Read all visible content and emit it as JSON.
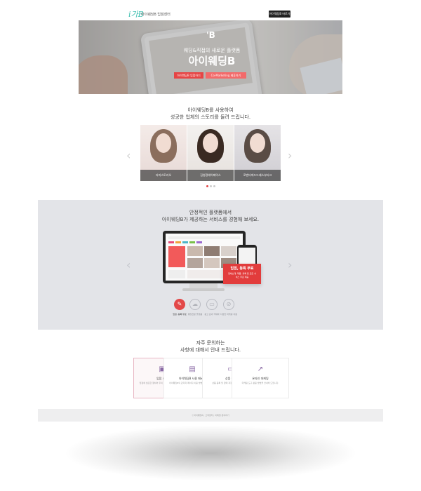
{
  "header": {
    "logo_mark": "i가B",
    "logo_text": "아이웨딩B 입점센터",
    "top_button": "아이웨딩B 바로가기"
  },
  "hero": {
    "badge": "'B",
    "subtitle": "웨딩&직접의 새로운 플랫폼",
    "title": "아이웨딩B",
    "button_primary": "아이웨딩B 입점하기",
    "button_secondary": "Co-Marketing 제휴하기"
  },
  "stories": {
    "heading_line1": "아이웨딩B를 사용하여",
    "heading_line2": "성공한 업체의 스토리를 들려 드립니다.",
    "cards": [
      {
        "caption": "타미스토리오"
      },
      {
        "caption": "김청경헤어페이스"
      },
      {
        "caption": "로맨티에드드레스부티크"
      }
    ]
  },
  "platform": {
    "heading_line1": "안정적인 플랫폼에서",
    "heading_line2": "아이웨딩B가 제공하는 서비스를 경험해 보세요.",
    "promo_title": "입점, 등록 무료",
    "promo_desc": "업체소개, 제품, 블록 등 모든 서비스 무료 제공",
    "features": [
      {
        "label": "입점, 등록 무료",
        "icon": "tag-icon"
      },
      {
        "label": "웨딩전문 플랫폼",
        "icon": "cloud-icon"
      },
      {
        "label": "광고 효과 극대화",
        "icon": "chat-icon"
      },
      {
        "label": "다양한 마케팅 지원",
        "icon": "ban-icon"
      }
    ]
  },
  "faq": {
    "heading_line1": "자주 문의하는",
    "heading_line2": "사항에 대해서 안내 드립니다.",
    "cards": [
      {
        "title": "입점 시작",
        "desc": "입점에 필요한 절차와 주의 사항을 안내해 드립니다."
      },
      {
        "title": "아이웨딩B 사용 매뉴얼",
        "desc": "아이웨딩B의 관리자 페이지 이용 방법을 안내합니다."
      },
      {
        "title": "상품 판매",
        "desc": "상품 등록 및 판매 과정을 안내해 드립니다."
      },
      {
        "title": "온라인 마케팅",
        "desc": "마케팅 도구 활용 방법을 안내해 드립니다."
      }
    ]
  },
  "footer": {
    "text": "ⓒ아이웨딩B   |   고객센터   |   이메일 문의하기"
  },
  "colors": {
    "accent": "#e34848",
    "panel": "#e3e4e8",
    "footer": "#eeeeef"
  }
}
